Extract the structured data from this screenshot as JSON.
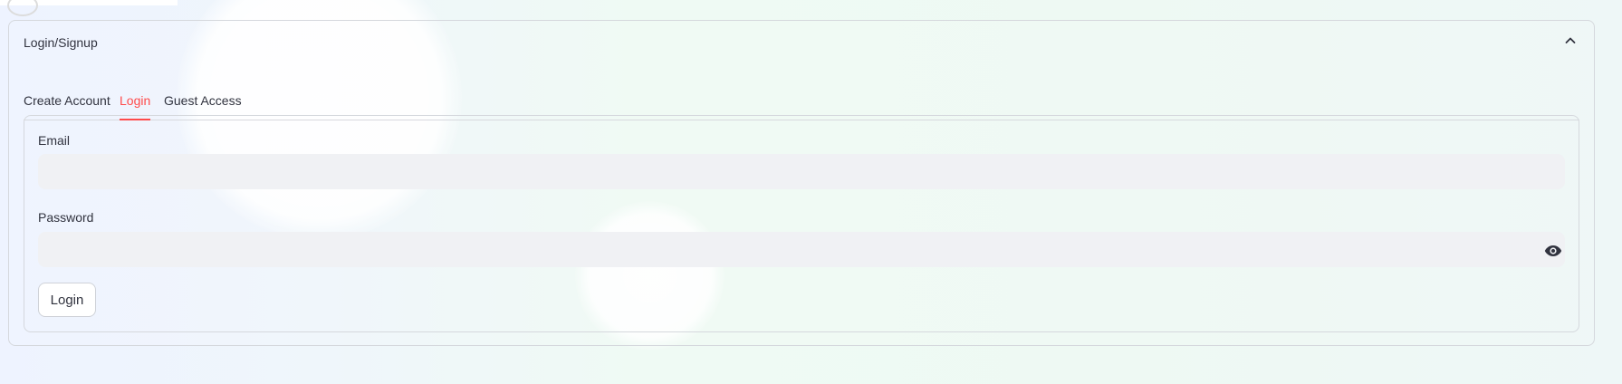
{
  "expander": {
    "title": "Login/Signup",
    "expanded": true
  },
  "tabs": [
    {
      "label": "Create Account",
      "active": false
    },
    {
      "label": "Login",
      "active": true
    },
    {
      "label": "Guest Access",
      "active": false
    }
  ],
  "form": {
    "email_label": "Email",
    "email_value": "",
    "password_label": "Password",
    "password_value": "",
    "login_button_label": "Login"
  },
  "icons": {
    "collapse": "chevron-up-icon",
    "password_toggle": "eye-icon"
  },
  "colors": {
    "accent": "#ff4b4b",
    "input_background": "#f0f1f4",
    "border": "#d5d8dd",
    "text": "#31333f"
  }
}
